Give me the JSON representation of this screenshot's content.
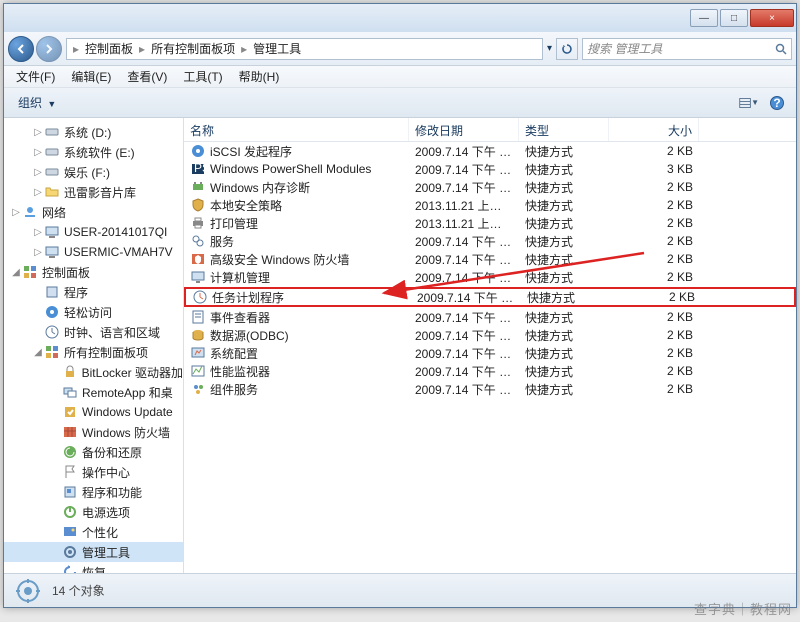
{
  "titlebar": {
    "min": "—",
    "max": "□",
    "close": "×"
  },
  "nav": {
    "crumbs": [
      "控制面板",
      "所有控制面板项",
      "管理工具"
    ],
    "search_placeholder": "搜索 管理工具"
  },
  "menu": {
    "file": "文件(F)",
    "edit": "编辑(E)",
    "view": "查看(V)",
    "tools": "工具(T)",
    "help": "帮助(H)"
  },
  "toolbar": {
    "organize": "组织"
  },
  "sidebar": {
    "items": [
      {
        "label": "系统 (D:)",
        "icon": "drive-icon",
        "level": 1,
        "tw": "▷"
      },
      {
        "label": "系统软件 (E:)",
        "icon": "drive-icon",
        "level": 1,
        "tw": "▷"
      },
      {
        "label": "娱乐 (F:)",
        "icon": "drive-icon",
        "level": 1,
        "tw": "▷"
      },
      {
        "label": "迅雷影音片库",
        "icon": "folder-icon",
        "level": 1,
        "tw": "▷"
      },
      {
        "label": "网络",
        "icon": "network-icon",
        "level": 0,
        "tw": "▷"
      },
      {
        "label": "USER-20141017QI",
        "icon": "computer-icon",
        "level": 1,
        "tw": "▷"
      },
      {
        "label": "USERMIC-VMAH7V",
        "icon": "computer-icon",
        "level": 1,
        "tw": "▷"
      },
      {
        "label": "控制面板",
        "icon": "cpanel-icon",
        "level": 0,
        "tw": "◢"
      },
      {
        "label": "程序",
        "icon": "programs-icon",
        "level": 1,
        "tw": ""
      },
      {
        "label": "轻松访问",
        "icon": "ease-icon",
        "level": 1,
        "tw": ""
      },
      {
        "label": "时钟、语言和区域",
        "icon": "clock-icon",
        "level": 1,
        "tw": ""
      },
      {
        "label": "所有控制面板项",
        "icon": "cpanel-icon",
        "level": 1,
        "tw": "◢"
      },
      {
        "label": "BitLocker 驱动器加",
        "icon": "bitlocker-icon",
        "level": 2,
        "tw": ""
      },
      {
        "label": "RemoteApp 和桌",
        "icon": "remoteapp-icon",
        "level": 2,
        "tw": ""
      },
      {
        "label": "Windows Update",
        "icon": "update-icon",
        "level": 2,
        "tw": ""
      },
      {
        "label": "Windows 防火墙",
        "icon": "firewall-icon",
        "level": 2,
        "tw": ""
      },
      {
        "label": "备份和还原",
        "icon": "backup-icon",
        "level": 2,
        "tw": ""
      },
      {
        "label": "操作中心",
        "icon": "flag-icon",
        "level": 2,
        "tw": ""
      },
      {
        "label": "程序和功能",
        "icon": "programs2-icon",
        "level": 2,
        "tw": ""
      },
      {
        "label": "电源选项",
        "icon": "power-icon",
        "level": 2,
        "tw": ""
      },
      {
        "label": "个性化",
        "icon": "personalize-icon",
        "level": 2,
        "tw": ""
      },
      {
        "label": "管理工具",
        "icon": "admin-icon",
        "level": 2,
        "tw": "",
        "sel": true
      },
      {
        "label": "恢复",
        "icon": "recovery-icon",
        "level": 2,
        "tw": ""
      }
    ]
  },
  "columns": {
    "name": "名称",
    "date": "修改日期",
    "type": "类型",
    "size": "大小"
  },
  "files": [
    {
      "name": "iSCSI 发起程序",
      "date": "2009.7.14 下午 1...",
      "type": "快捷方式",
      "size": "2 KB",
      "icon": "iscsi-icon"
    },
    {
      "name": "Windows PowerShell Modules",
      "date": "2009.7.14 下午 1...",
      "type": "快捷方式",
      "size": "3 KB",
      "icon": "ps-icon"
    },
    {
      "name": "Windows 内存诊断",
      "date": "2009.7.14 下午 1...",
      "type": "快捷方式",
      "size": "2 KB",
      "icon": "memdiag-icon"
    },
    {
      "name": "本地安全策略",
      "date": "2013.11.21 上午 ...",
      "type": "快捷方式",
      "size": "2 KB",
      "icon": "secpol-icon"
    },
    {
      "name": "打印管理",
      "date": "2013.11.21 上午 ...",
      "type": "快捷方式",
      "size": "2 KB",
      "icon": "print-icon"
    },
    {
      "name": "服务",
      "date": "2009.7.14 下午 1...",
      "type": "快捷方式",
      "size": "2 KB",
      "icon": "services-icon"
    },
    {
      "name": "高级安全 Windows 防火墙",
      "date": "2009.7.14 下午 1...",
      "type": "快捷方式",
      "size": "2 KB",
      "icon": "wfadv-icon"
    },
    {
      "name": "计算机管理",
      "date": "2009.7.14 下午 1...",
      "type": "快捷方式",
      "size": "2 KB",
      "icon": "compmgmt-icon"
    },
    {
      "name": "任务计划程序",
      "date": "2009.7.14 下午 1...",
      "type": "快捷方式",
      "size": "2 KB",
      "icon": "tasksched-icon",
      "highlight": true
    },
    {
      "name": "事件查看器",
      "date": "2009.7.14 下午 1...",
      "type": "快捷方式",
      "size": "2 KB",
      "icon": "eventvwr-icon"
    },
    {
      "name": "数据源(ODBC)",
      "date": "2009.7.14 下午 1...",
      "type": "快捷方式",
      "size": "2 KB",
      "icon": "odbc-icon"
    },
    {
      "name": "系统配置",
      "date": "2009.7.14 下午 1...",
      "type": "快捷方式",
      "size": "2 KB",
      "icon": "msconfig-icon"
    },
    {
      "name": "性能监视器",
      "date": "2009.7.14 下午 1...",
      "type": "快捷方式",
      "size": "2 KB",
      "icon": "perfmon-icon"
    },
    {
      "name": "组件服务",
      "date": "2009.7.14 下午 1...",
      "type": "快捷方式",
      "size": "2 KB",
      "icon": "comsvc-icon"
    }
  ],
  "status": {
    "count_text": "14 个对象"
  },
  "watermark": "查字典｜教程网"
}
